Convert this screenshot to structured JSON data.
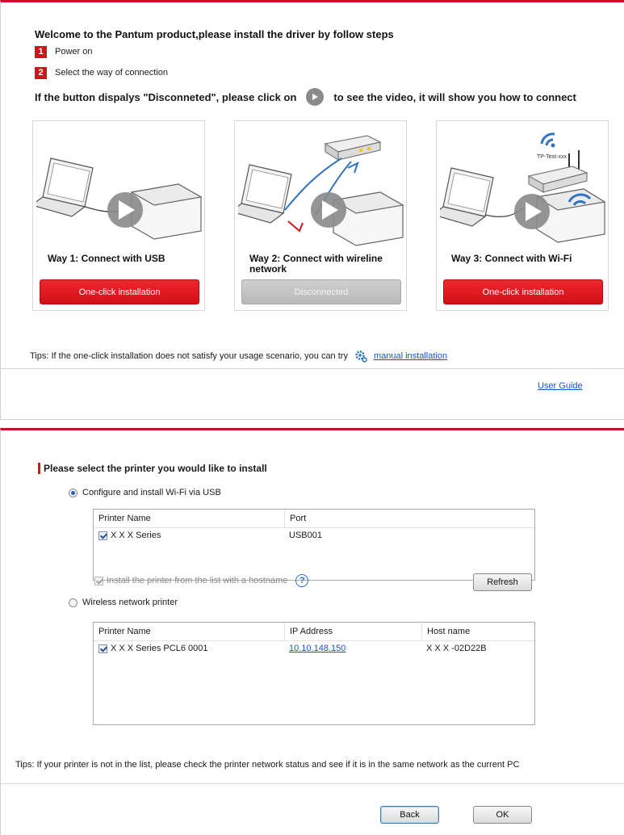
{
  "installer": {
    "title": "Welcome to the Pantum product,please install the driver by follow steps",
    "steps": [
      {
        "num": "1",
        "label": "Power on"
      },
      {
        "num": "2",
        "label": "Select the way of connection"
      }
    ],
    "hint_before": "If the button dispalys \"Disconneted\", please click on",
    "hint_after": "to see the video, it will show you how to connect",
    "cards": [
      {
        "label": "Way 1: Connect with USB",
        "button": "One-click installation",
        "state": "enabled"
      },
      {
        "label": "Way 2: Connect with wireline network",
        "button": "Disconnected",
        "state": "disabled"
      },
      {
        "label": "Way 3: Connect with Wi-Fi",
        "button": "One-click installation",
        "state": "enabled",
        "router_label": "TP-Test-xxx"
      }
    ],
    "tips": "Tips: If the one-click installation does not satisfy your usage scenario, you can try",
    "manual_link": "manual installation",
    "user_guide": "User Guide"
  },
  "select_printer": {
    "title": "Please select the printer you would like to install",
    "option_usb": {
      "label": "Configure and install Wi-Fi via USB",
      "selected": true
    },
    "usb_table": {
      "headers": [
        "Printer Name",
        "Port"
      ],
      "rows": [
        {
          "checked": true,
          "name": "X X X  Series",
          "port": "USB001"
        }
      ]
    },
    "option_wireless": {
      "label": "Wireless network printer",
      "selected": false
    },
    "wireless_table": {
      "headers": [
        "Printer Name",
        "IP Address",
        "Host name"
      ],
      "rows": [
        {
          "checked": true,
          "name": "X X X  Series PCL6 0001",
          "ip": "10.10.148.150",
          "host": "X X X -02D22B"
        }
      ]
    },
    "hostname_option": "Install the printer from the list with a hostname",
    "help": "?",
    "refresh": "Refresh",
    "tips": "Tips: If your printer is not in the list, please check the printer network status and see if it is in the same network as the current PC",
    "back": "Back",
    "ok": "OK"
  },
  "colors": {
    "accent": "#d2141e",
    "link": "#1a4fd1"
  }
}
